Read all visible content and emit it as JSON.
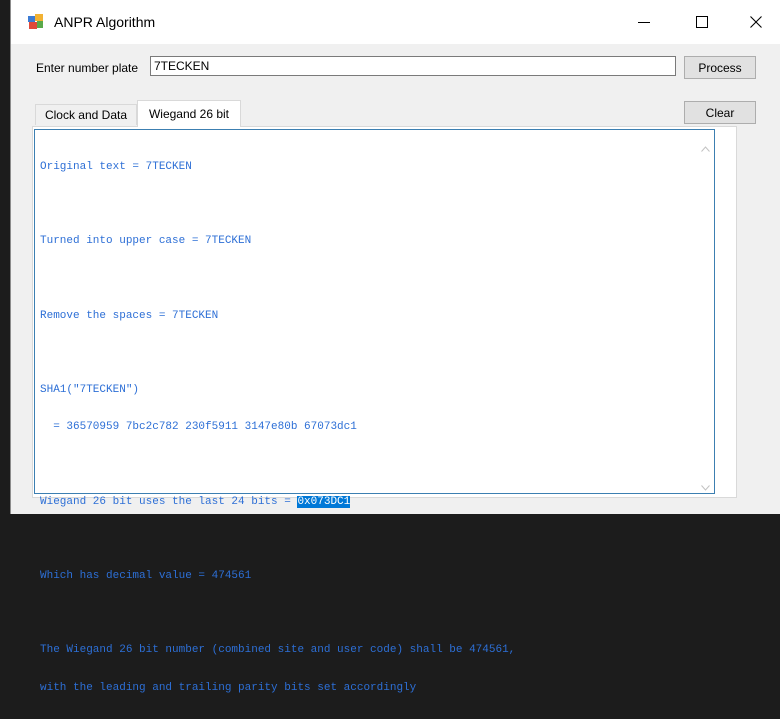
{
  "window": {
    "title": "ANPR Algorithm"
  },
  "form": {
    "plate_label": "Enter number plate",
    "plate_value": "7TECKEN",
    "process_label": "Process",
    "clear_label": "Clear"
  },
  "tabs": [
    {
      "label": "Clock and Data",
      "active": false
    },
    {
      "label": "Wiegand 26 bit",
      "active": true
    }
  ],
  "output": {
    "line1": "Original text = 7TECKEN",
    "line2": "Turned into upper case = 7TECKEN",
    "line3": "Remove the spaces = 7TECKEN",
    "line4a": "SHA1(\"7TECKEN\")",
    "line4b": "  = 36570959 7bc2c782 230f5911 3147e80b 67073dc1",
    "line5_prefix": "Wiegand 26 bit uses the last 24 bits = ",
    "line5_selected": "0x073DC1",
    "line6": "Which has decimal value = 474561",
    "line7a": "The Wiegand 26 bit number (combined site and user code) shall be 474561,",
    "line7b": "with the leading and trailing parity bits set accordingly"
  },
  "icons": {
    "app": "application-icon",
    "minimize": "minimize-icon",
    "maximize": "maximize-icon",
    "close": "close-icon",
    "scroll_up": "chevron-up-icon",
    "scroll_down": "chevron-down-icon"
  },
  "colors": {
    "output_text": "#2d6fd6",
    "selection": "#0078d7",
    "textbox_border": "#3c7fb1"
  }
}
